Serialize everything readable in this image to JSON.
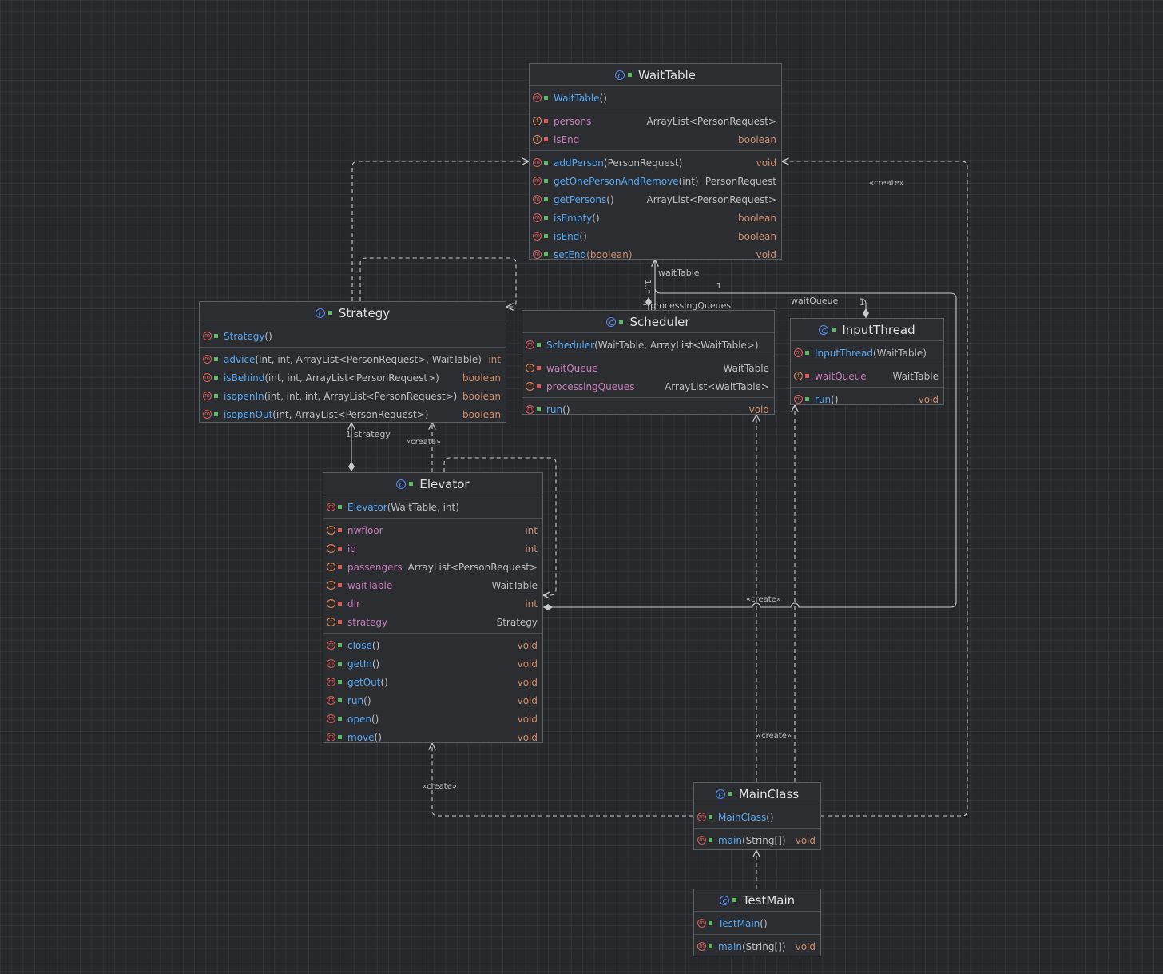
{
  "classes": {
    "waittable": {
      "name": "WaitTable",
      "constructor": {
        "name": "WaitTable",
        "params": "()"
      },
      "fields": [
        {
          "name": "persons",
          "type": "ArrayList<PersonRequest>"
        },
        {
          "name": "isEnd",
          "type": "boolean"
        }
      ],
      "methods": [
        {
          "name": "addPerson",
          "params": "(PersonRequest)",
          "type": "void"
        },
        {
          "name": "getOnePersonAndRemove",
          "params": "(int)",
          "type": "PersonRequest"
        },
        {
          "name": "getPersons",
          "params": "()",
          "type": "ArrayList<PersonRequest>"
        },
        {
          "name": "isEmpty",
          "params": "()",
          "type": "boolean"
        },
        {
          "name": "isEnd",
          "params": "()",
          "type": "boolean"
        },
        {
          "name": "setEnd",
          "params": "(boolean)",
          "type": "void"
        }
      ]
    },
    "strategy": {
      "name": "Strategy",
      "constructor": {
        "name": "Strategy",
        "params": "()"
      },
      "methods": [
        {
          "name": "advice",
          "params": "(int, int, ArrayList<PersonRequest>, WaitTable)",
          "type": "int"
        },
        {
          "name": "isBehind",
          "params": "(int, int, ArrayList<PersonRequest>)",
          "type": "boolean"
        },
        {
          "name": "isopenIn",
          "params": "(int, int, int, ArrayList<PersonRequest>)",
          "type": "boolean"
        },
        {
          "name": "isopenOut",
          "params": "(int, ArrayList<PersonRequest>)",
          "type": "boolean"
        }
      ]
    },
    "scheduler": {
      "name": "Scheduler",
      "constructor": {
        "name": "Scheduler",
        "params": "(WaitTable, ArrayList<WaitTable>)"
      },
      "fields": [
        {
          "name": "waitQueue",
          "type": "WaitTable"
        },
        {
          "name": "processingQueues",
          "type": "ArrayList<WaitTable>"
        }
      ],
      "methods": [
        {
          "name": "run",
          "params": "()",
          "type": "void"
        }
      ]
    },
    "inputthread": {
      "name": "InputThread",
      "constructor": {
        "name": "InputThread",
        "params": "(WaitTable)"
      },
      "fields": [
        {
          "name": "waitQueue",
          "type": "WaitTable"
        }
      ],
      "methods": [
        {
          "name": "run",
          "params": "()",
          "type": "void"
        }
      ]
    },
    "elevator": {
      "name": "Elevator",
      "constructor": {
        "name": "Elevator",
        "params": "(WaitTable, int)"
      },
      "fields": [
        {
          "name": "nwfloor",
          "type": "int"
        },
        {
          "name": "id",
          "type": "int"
        },
        {
          "name": "passengers",
          "type": "ArrayList<PersonRequest>"
        },
        {
          "name": "waitTable",
          "type": "WaitTable"
        },
        {
          "name": "dir",
          "type": "int"
        },
        {
          "name": "strategy",
          "type": "Strategy"
        }
      ],
      "methods": [
        {
          "name": "close",
          "params": "()",
          "type": "void"
        },
        {
          "name": "getIn",
          "params": "()",
          "type": "void"
        },
        {
          "name": "getOut",
          "params": "()",
          "type": "void"
        },
        {
          "name": "run",
          "params": "()",
          "type": "void"
        },
        {
          "name": "open",
          "params": "()",
          "type": "void"
        },
        {
          "name": "move",
          "params": "()",
          "type": "void"
        }
      ]
    },
    "mainclass": {
      "name": "MainClass",
      "constructor": {
        "name": "MainClass",
        "params": "()"
      },
      "methods": [
        {
          "name": "main",
          "params": "(String[])",
          "type": "void"
        }
      ]
    },
    "testmain": {
      "name": "TestMain",
      "constructor": {
        "name": "TestMain",
        "params": "()"
      },
      "methods": [
        {
          "name": "main",
          "params": "(String[])",
          "type": "void"
        }
      ]
    }
  },
  "edge_labels": {
    "create": "«create»",
    "waittable_role": "waitTable",
    "processing_role": "processingQueues",
    "waitqueue_role": "waitQueue",
    "strategy_role": "strategy",
    "mult_many": "1..*",
    "mult_one": "1"
  },
  "colors": {
    "background": "#26282b",
    "box": "#2b2d30",
    "method": "#56a8f5",
    "field": "#c77dbb",
    "keyword": "#cf8e6d",
    "text": "#bcbec4",
    "edge": "#c8cacf"
  }
}
